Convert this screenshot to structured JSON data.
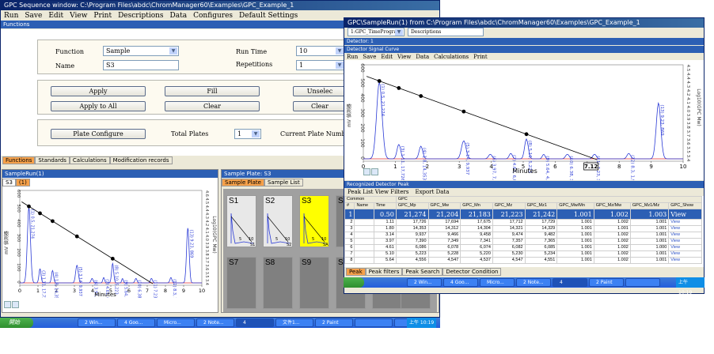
{
  "main_window": {
    "title": "GPC Sequence window: C:\\Program Files\\abdc\\ChromManager60\\Examples\\GPC_Example_1",
    "menu": [
      "Run",
      "Save",
      "Edit",
      "View",
      "Print",
      "Descriptions",
      "Data",
      "Configures",
      "Default Settings"
    ],
    "functions_header": "Functions",
    "function_label": "Function",
    "function_value": "Sample",
    "name_label": "Name",
    "name_value": "S3",
    "run_time_label": "Run Time",
    "run_time_value": "10",
    "repetitions_label": "Repetitions",
    "repetitions_value": "1",
    "apply_label": "Apply",
    "fill_label": "Fill",
    "unselect_label": "Unselec",
    "apply_all_label": "Apply to All",
    "clear_label": "Clear",
    "clear2_label": "Clear",
    "plate_configure_label": "Plate Configure",
    "total_plates_label": "Total Plates",
    "total_plates_value": "1",
    "current_plate_label": "Current Plate Number",
    "tabs": [
      "Functions",
      "Standards",
      "Calculations",
      "Modification records"
    ],
    "sample_run_title": "SampleRun(1)",
    "sample_run_tabs": [
      "S3",
      "(1)"
    ],
    "sample_run_xaxis": "Minutes",
    "sample_run_ylabel": "mV 偵測器",
    "sample_run_right_label": "Log10(GPC Mw)",
    "sample_run_x_ticks": [
      "0",
      "1",
      "2",
      "3",
      "4",
      "5",
      "6",
      "7",
      "8",
      "9",
      "10"
    ],
    "sample_run_y_ticks": [
      "600",
      "500",
      "400",
      "300",
      "200",
      "100",
      "0"
    ],
    "sample_run_right_ticks": [
      "4.6",
      "4.5",
      "4.4",
      "4.3",
      "4.2",
      "4.1",
      "4.0",
      "3.9",
      "3.8",
      "3.7",
      "3.6",
      "3.5",
      "3.4"
    ],
    "sample_plate_title": "Sample Plate: S3",
    "plate_tabs": [
      "Sample Plate",
      "Sample List"
    ],
    "plates": [
      {
        "label": "S1",
        "style": "normal"
      },
      {
        "label": "S2",
        "style": "normal"
      },
      {
        "label": "S3",
        "style": "yellow"
      },
      {
        "label": "S4",
        "style": "gray"
      },
      {
        "label": "S7",
        "style": "gray"
      },
      {
        "label": "S8",
        "style": "gray"
      },
      {
        "label": "S9",
        "style": "gray"
      },
      {
        "label": "S10",
        "style": "gray"
      }
    ],
    "plate_ticks": [
      "5",
      "10"
    ],
    "plate_tags": [
      "S1",
      "S2",
      "SA"
    ]
  },
  "sample_window": {
    "title": "GPC\\SampleRun(1) from C:\\Program Files\\abdc\\ChromManager60\\Examples\\GPC_Example_1",
    "combo1": "1:GPC_TimeProgram",
    "combo2": "Descriptions",
    "detector_header": "Detector: 1",
    "signal_header": "Detector Signal Curve",
    "menu": [
      "Run",
      "Save",
      "Edit",
      "View",
      "Data",
      "Calculations",
      "Print"
    ],
    "xaxis_label": "Minutes",
    "ylabel_left": "mV 偵測器",
    "ylabel_right": "Log10(GPC Mw)",
    "x_ticks": [
      "0",
      "1",
      "2",
      "3",
      "4",
      "5",
      "6",
      "7",
      "8",
      "9",
      "10"
    ],
    "x_highlight": "7.12",
    "y_ticks": [
      "600",
      "500",
      "400",
      "300",
      "200",
      "100",
      "0"
    ],
    "right_ticks": [
      "4.5",
      "4.4",
      "4.3",
      "4.2",
      "4.1",
      "4.0",
      "3.9",
      "3.8",
      "3.7",
      "3.6",
      "3.5",
      "3.4"
    ],
    "peak_labels": [
      "(1) 0.5, 21,274",
      "(3) 1.11, 17,726",
      "(4) 1.8, 14,353",
      "(5) 3.14, 9,937",
      "(6) 3.97, 7,390",
      "(7) 4.61, 6,086",
      "(8) 5.10, 5,223",
      "(9) 5.64, 4,556",
      "(10) 6.38, 3,764",
      "(11) 7.23, 3,230",
      "(12) 8.3, 1,932",
      "(13) 9.23, 869"
    ],
    "peak_section": "Recognized Detector Peak",
    "peak_menu": [
      "Peak List View Filters",
      "Export Data"
    ],
    "table_group_common": "Common",
    "table_group_gpc": "GPC",
    "table_headers": [
      "#",
      "Name",
      "Time",
      "GPC_Mp",
      "GPC_Mw",
      "GPC_Mn",
      "GPC_Mz",
      "GPC_Mz1",
      "GPC_Mw/Mn",
      "GPC_Mz/Mw",
      "GPC_Mz1/Mz",
      "GPC_Show"
    ],
    "table_rows": [
      [
        "1",
        "",
        "0.50",
        "21,274",
        "21,204",
        "21,183",
        "21,223",
        "21,242",
        "1.001",
        "1.002",
        "1.003",
        "View"
      ],
      [
        "2",
        "",
        "1.11",
        "17,726",
        "17,694",
        "17,675",
        "17,712",
        "17,729",
        "1.001",
        "1.002",
        "1.001",
        "View"
      ],
      [
        "3",
        "",
        "1.80",
        "14,353",
        "14,312",
        "14,304",
        "14,321",
        "14,329",
        "1.001",
        "1.001",
        "1.001",
        "View"
      ],
      [
        "4",
        "",
        "3.14",
        "9,937",
        "9,466",
        "9,458",
        "9,474",
        "9,482",
        "1.001",
        "1.002",
        "1.001",
        "View"
      ],
      [
        "5",
        "",
        "3.97",
        "7,390",
        "7,349",
        "7,341",
        "7,357",
        "7,365",
        "1.001",
        "1.002",
        "1.001",
        "View"
      ],
      [
        "6",
        "",
        "4.61",
        "6,086",
        "6,078",
        "6,074",
        "6,082",
        "6,085",
        "1.001",
        "1.002",
        "1.000",
        "View"
      ],
      [
        "7",
        "",
        "5.10",
        "5,223",
        "5,228",
        "5,220",
        "5,230",
        "5,234",
        "1.001",
        "1.002",
        "1.001",
        "View"
      ],
      [
        "8",
        "",
        "5.64",
        "4,556",
        "4,547",
        "4,537",
        "4,547",
        "4,551",
        "1.001",
        "1.002",
        "1.001",
        "View"
      ]
    ],
    "bottom_tabs": [
      "Peak",
      "Peak filters",
      "Peak Search",
      "Detector Condition"
    ]
  },
  "taskbar_main": {
    "start": "開始",
    "items": [
      "2 Win...",
      "4 Goo...",
      "Micro...",
      "2 Note...",
      "4",
      "文件1...",
      "2 Paint",
      "",
      ""
    ],
    "time": "上午 10:19"
  },
  "taskbar_second": {
    "items": [
      "2 Win...",
      "4 Goo...",
      "Micro...",
      "2 Note...",
      "4",
      "2 Paint",
      ""
    ],
    "time": "上午 10:19"
  },
  "colors": {
    "title_blue": "#0a246a",
    "header_blue": "#2c5fb4",
    "curve_blue": "#2b3bd6",
    "calibration_line": "#000000",
    "baseline_red": "#e03030",
    "tab_orange": "#f6a14a",
    "selected_plate": "#ffff00"
  }
}
